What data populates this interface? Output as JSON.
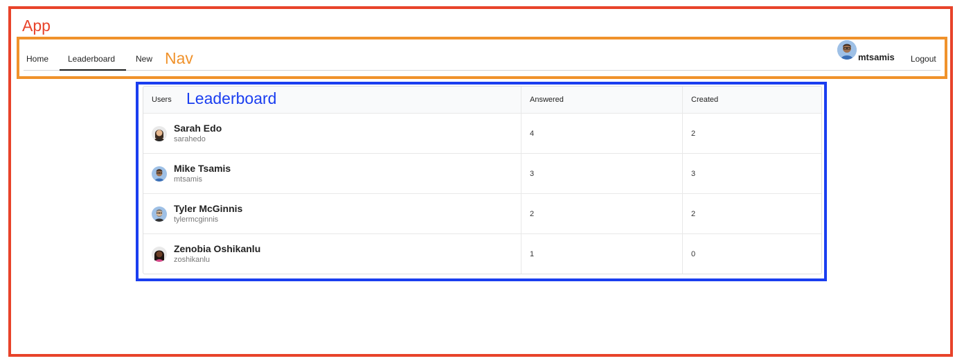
{
  "labels": {
    "app": "App",
    "nav": "Nav",
    "leaderboard": "Leaderboard"
  },
  "nav": {
    "items": [
      {
        "label": "Home"
      },
      {
        "label": "Leaderboard",
        "active": true
      },
      {
        "label": "New"
      }
    ],
    "user": "mtsamis",
    "logout": "Logout"
  },
  "table": {
    "headers": [
      "Users",
      "Answered",
      "Created"
    ],
    "rows": [
      {
        "name": "Sarah Edo",
        "username": "sarahedo",
        "answered": "4",
        "created": "2",
        "avatar_skin": "#e8b98f",
        "avatar_hair": "#3a2a1f",
        "avatar_bg": "#e9e9e9"
      },
      {
        "name": "Mike Tsamis",
        "username": "mtsamis",
        "answered": "3",
        "created": "3",
        "avatar_skin": "#a0714f",
        "avatar_hair": "#3d2a1e",
        "avatar_bg": "#9ec0e6"
      },
      {
        "name": "Tyler McGinnis",
        "username": "tylermcginnis",
        "answered": "2",
        "created": "2",
        "avatar_skin": "#e8c4a0",
        "avatar_hair": "#7a7a7a",
        "avatar_bg": "#9ec0e6"
      },
      {
        "name": "Zenobia Oshikanlu",
        "username": "zoshikanlu",
        "answered": "1",
        "created": "0",
        "avatar_skin": "#6b3e26",
        "avatar_hair": "#1e1410",
        "avatar_bg": "#e9e9e9"
      }
    ]
  },
  "colors": {
    "app_frame": "#e8432a",
    "nav_frame": "#f0922b",
    "leaderboard_frame": "#1a3ef0"
  }
}
